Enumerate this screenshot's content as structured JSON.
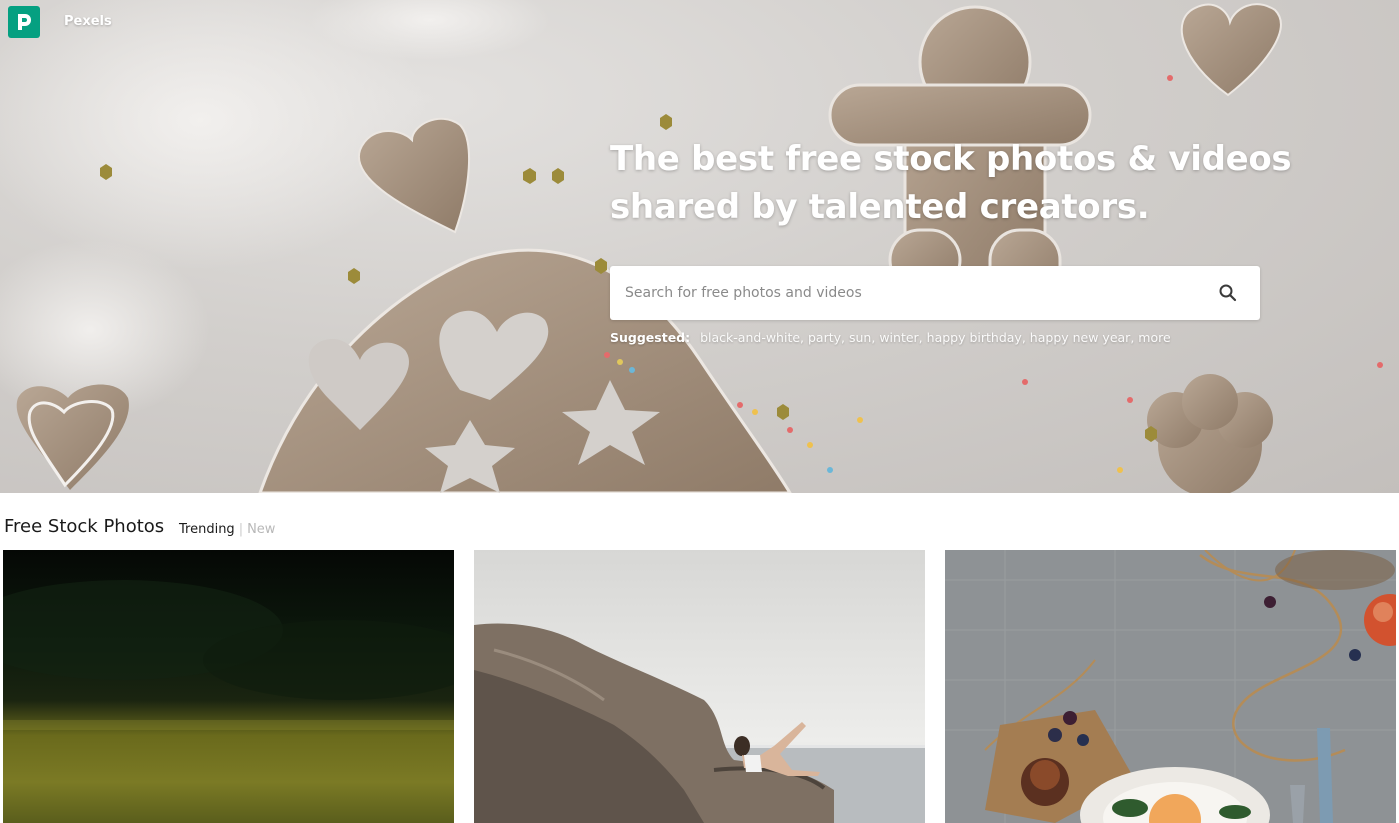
{
  "brand": {
    "name": "Pexels"
  },
  "hero": {
    "headline_line1": "The best free stock photos & videos",
    "headline_line2": "shared by talented creators."
  },
  "search": {
    "placeholder": "Search for free photos and videos",
    "icon": "search-icon"
  },
  "suggested": {
    "label": "Suggested:",
    "items": [
      "black-and-white,",
      "party,",
      "sun,",
      "winter,",
      "happy birthday,",
      "happy new year,",
      "more"
    ]
  },
  "section": {
    "title": "Free Stock Photos",
    "filter_trending": "Trending",
    "filter_separator": "|",
    "filter_new": "New"
  },
  "colors": {
    "brand_green": "#05a081",
    "text_dark": "#1a1a1a",
    "text_muted": "#b8b8b8"
  }
}
